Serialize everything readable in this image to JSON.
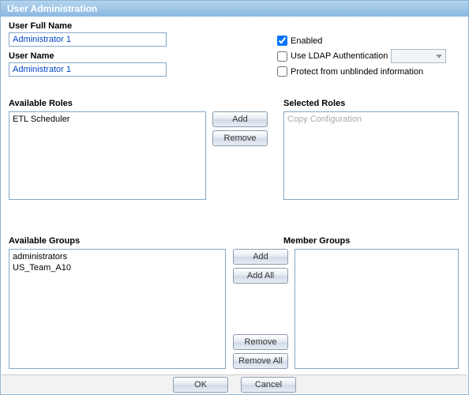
{
  "window": {
    "title": "User Administration"
  },
  "fields": {
    "fullname_label": "User Full Name",
    "fullname_value": "Administrator 1",
    "username_label": "User Name",
    "username_value": "Administrator 1"
  },
  "checkboxes": {
    "enabled_label": "Enabled",
    "enabled_checked": true,
    "ldap_label": "Use LDAP Authentication",
    "ldap_checked": false,
    "protect_label": "Protect from unblinded information",
    "protect_checked": false
  },
  "roles": {
    "available_label": "Available Roles",
    "available_items": [
      "ETL Scheduler"
    ],
    "selected_label": "Selected Roles",
    "selected_placeholder": "Copy Configuration",
    "add_label": "Add",
    "remove_label": "Remove"
  },
  "groups": {
    "available_label": "Available Groups",
    "available_items": [
      "administrators",
      "US_Team_A10"
    ],
    "member_label": "Member Groups",
    "add_label": "Add",
    "addall_label": "Add All",
    "remove_label": "Remove",
    "removeall_label": "Remove All"
  },
  "footer": {
    "ok_label": "OK",
    "cancel_label": "Cancel"
  }
}
